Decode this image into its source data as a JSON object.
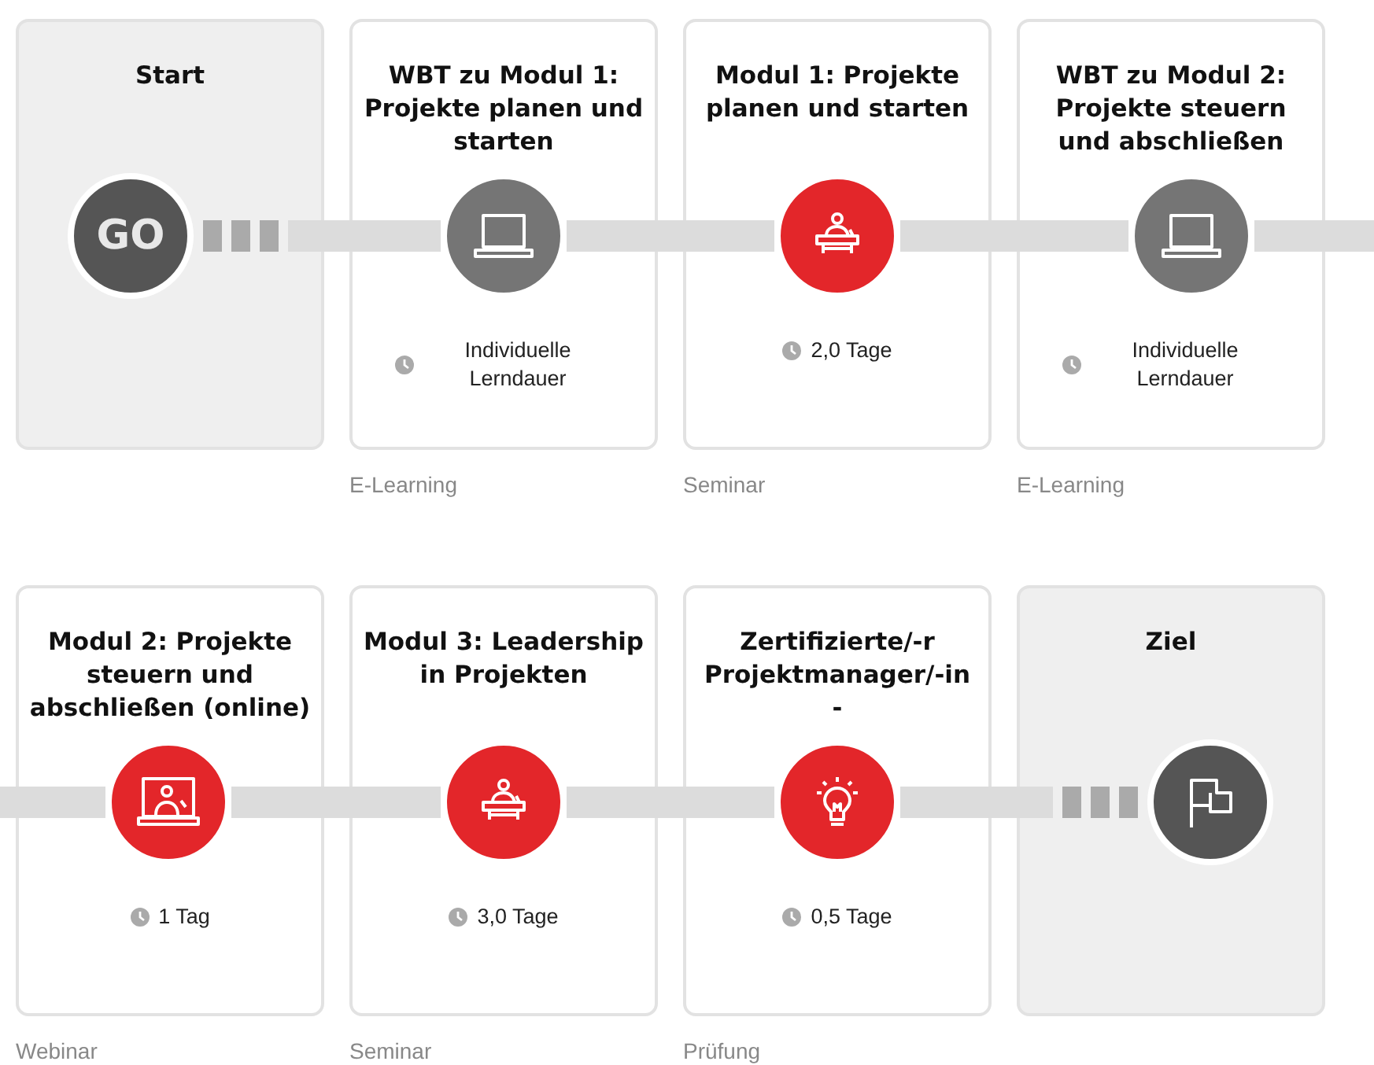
{
  "rows": [
    {
      "steps": [
        {
          "kind": "start",
          "title": "Start",
          "badge": "GO"
        },
        {
          "kind": "elearning",
          "title": "WBT zu Modul 1: Projekte planen und starten",
          "color": "#757575",
          "duration": "Individuelle Lerndauer",
          "type": "E-Learning"
        },
        {
          "kind": "seminar",
          "title": "Modul 1: Projekte planen und starten",
          "color": "#e3262a",
          "duration": "2,0 Tage",
          "type": "Seminar"
        },
        {
          "kind": "elearning",
          "title": "WBT zu Modul 2: Projekte steuern und abschließen",
          "color": "#757575",
          "duration": "Individuelle Lerndauer",
          "type": "E-Learning"
        }
      ]
    },
    {
      "steps": [
        {
          "kind": "webinar",
          "title": "Modul 2: Projekte steuern und abschließen (online)",
          "color": "#e3262a",
          "duration": "1 Tag",
          "type": "Webinar"
        },
        {
          "kind": "seminar",
          "title": "Modul 3: Leadership in Projekten",
          "color": "#e3262a",
          "duration": "3,0 Tage",
          "type": "Seminar"
        },
        {
          "kind": "exam",
          "title": "Zertifizierte/-r Projektmanager/-in -",
          "color": "#e3262a",
          "duration": "0,5 Tage",
          "type": "Prüfung"
        },
        {
          "kind": "goal",
          "title": "Ziel"
        }
      ]
    }
  ]
}
